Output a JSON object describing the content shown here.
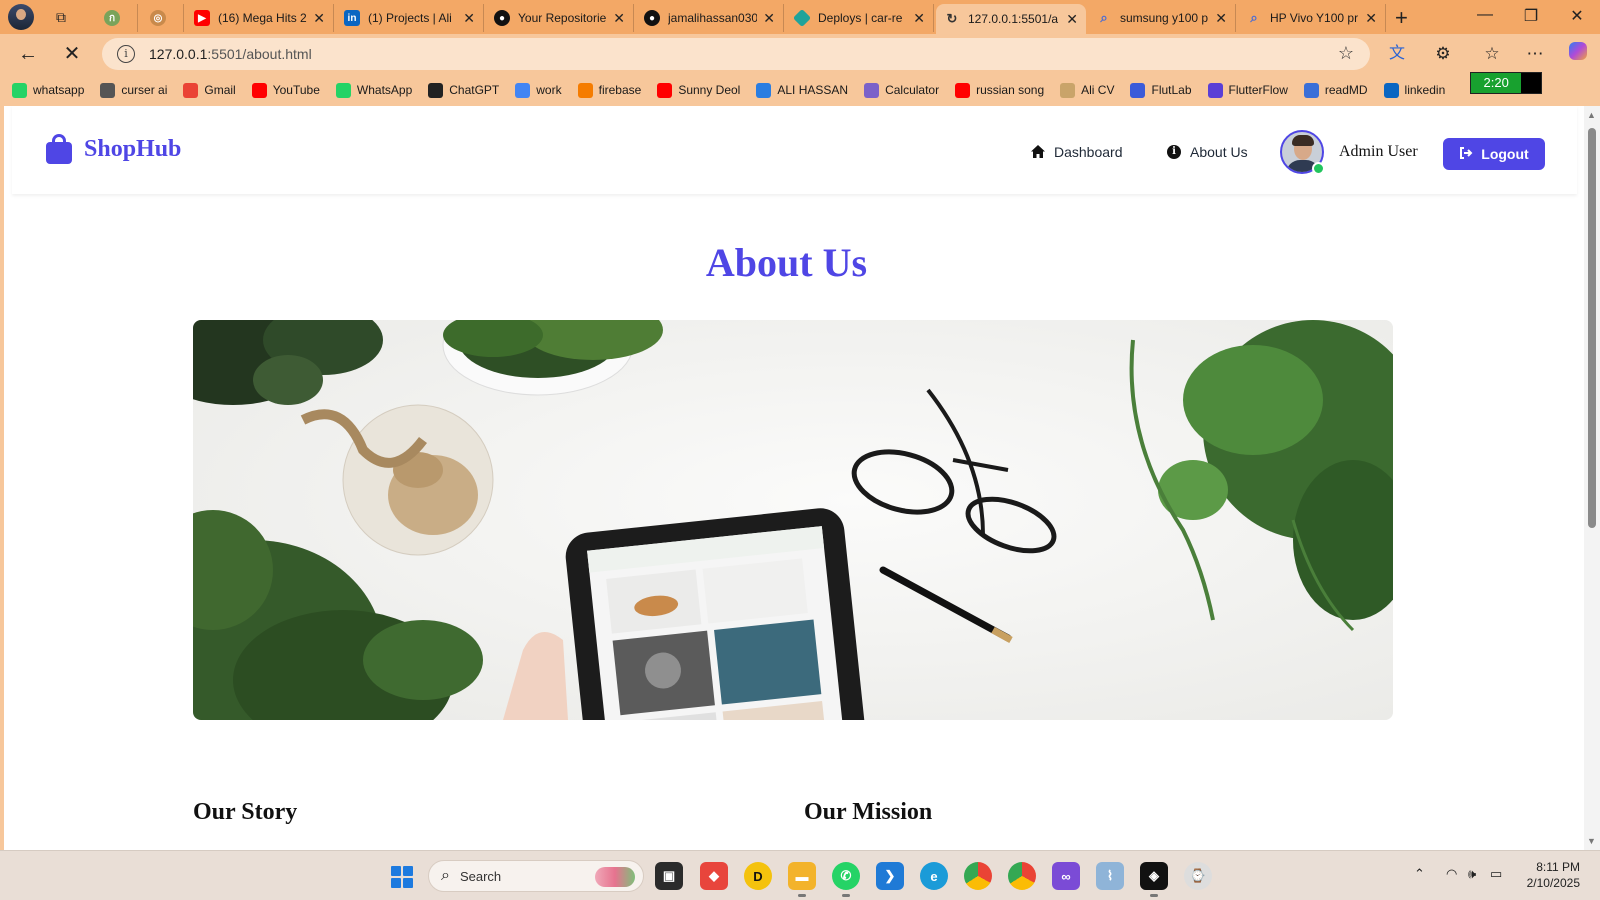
{
  "browser": {
    "tabs": [
      {
        "title": "",
        "icon": "green-app-icon",
        "color": "#7aa35a"
      },
      {
        "title": "",
        "icon": "circle-app-icon",
        "color": "#c98a4b"
      },
      {
        "title": "(16) Mega Hits 2",
        "icon": "youtube-icon",
        "color": "#ff0000"
      },
      {
        "title": "(1) Projects | Ali",
        "icon": "linkedin-icon",
        "color": "#0a66c2"
      },
      {
        "title": "Your Repositorie",
        "icon": "github-icon",
        "color": "#111111"
      },
      {
        "title": "jamalihassan030",
        "icon": "github-icon",
        "color": "#111111"
      },
      {
        "title": "Deploys | car-re",
        "icon": "netlify-icon",
        "color": "#20a39a"
      },
      {
        "title": "127.0.0.1:5501/a",
        "icon": "loading-icon",
        "color": "#333333",
        "active": true
      },
      {
        "title": "sumsung y100 p",
        "icon": "search-icon",
        "color": "#4a6cd4"
      },
      {
        "title": "HP Vivo Y100 pr",
        "icon": "search-icon",
        "color": "#4a6cd4"
      }
    ],
    "url_host": "127.0.0.1",
    "url_rest": ":5501/about.html",
    "bookmarks": [
      {
        "label": "whatsapp",
        "icon": "whatsapp-icon",
        "color": "#25d366"
      },
      {
        "label": "curser ai",
        "icon": "cursor-icon",
        "color": "#555555"
      },
      {
        "label": "Gmail",
        "icon": "gmail-icon",
        "color": "#ea4335"
      },
      {
        "label": "YouTube",
        "icon": "youtube-icon",
        "color": "#ff0000"
      },
      {
        "label": "WhatsApp",
        "icon": "whatsapp-icon",
        "color": "#25d366"
      },
      {
        "label": "ChatGPT",
        "icon": "chatgpt-icon",
        "color": "#222222"
      },
      {
        "label": "work",
        "icon": "docs-icon",
        "color": "#4285f4"
      },
      {
        "label": "firebase",
        "icon": "firebase-icon",
        "color": "#f57c00"
      },
      {
        "label": "Sunny Deol",
        "icon": "youtube-icon",
        "color": "#ff0000"
      },
      {
        "label": "ALI HASSAN",
        "icon": "flutter-icon",
        "color": "#2a7de1"
      },
      {
        "label": "Calculator",
        "icon": "calculator-icon",
        "color": "#7b61c9"
      },
      {
        "label": "russian song",
        "icon": "youtube-icon",
        "color": "#ff0000"
      },
      {
        "label": "Ali CV",
        "icon": "cv-icon",
        "color": "#c9a46a"
      },
      {
        "label": "FlutLab",
        "icon": "flutlab-icon",
        "color": "#3b5bd9"
      },
      {
        "label": "FlutterFlow",
        "icon": "flutterflow-icon",
        "color": "#5a3fd6"
      },
      {
        "label": "readMD",
        "icon": "readmd-icon",
        "color": "#3a6fd8"
      },
      {
        "label": "linkedin",
        "icon": "linkedin-icon",
        "color": "#0a66c2"
      }
    ],
    "battery_text": "2:20",
    "battery_level": 0.72
  },
  "site": {
    "brand": "ShopHub",
    "nav": {
      "dashboard": "Dashboard",
      "about": "About Us"
    },
    "user_name": "Admin User",
    "logout": "Logout",
    "page_title": "About Us",
    "hero_alt": "Workspace with plants, tablet, glasses and pen",
    "sections": {
      "story": "Our Story",
      "mission": "Our Mission"
    }
  },
  "taskbar": {
    "search_label": "Search",
    "time": "8:11 PM",
    "date": "2/10/2025"
  },
  "colors": {
    "accent": "#4f46e5",
    "online": "#22c55e"
  }
}
